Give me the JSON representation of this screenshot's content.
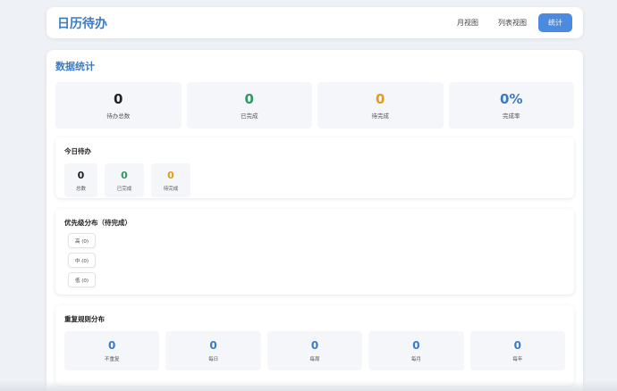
{
  "header": {
    "title": "日历待办",
    "nav": [
      {
        "label": "月视图"
      },
      {
        "label": "列表视图"
      },
      {
        "label": "统计"
      }
    ]
  },
  "stats": {
    "title": "数据统计",
    "summary": [
      {
        "value": "0",
        "label": "待办总数",
        "color": "#222222"
      },
      {
        "value": "0",
        "label": "已完成",
        "color": "#2e9a5f"
      },
      {
        "value": "0",
        "label": "待完成",
        "color": "#e59a1c"
      },
      {
        "value": "0%",
        "label": "完成率",
        "color": "#3a7bc8"
      }
    ]
  },
  "today": {
    "title": "今日待办",
    "items": [
      {
        "value": "0",
        "label": "总数"
      },
      {
        "value": "0",
        "label": "已完成"
      },
      {
        "value": "0",
        "label": "待完成"
      }
    ]
  },
  "priority": {
    "title": "优先级分布（待完成）",
    "items": [
      {
        "label": "高 (0)"
      },
      {
        "label": "中 (0)"
      },
      {
        "label": "低 (0)"
      }
    ]
  },
  "repeat": {
    "title": "重复规则分布",
    "items": [
      {
        "value": "0",
        "label": "不重复"
      },
      {
        "value": "0",
        "label": "每日"
      },
      {
        "value": "0",
        "label": "每周"
      },
      {
        "value": "0",
        "label": "每月"
      },
      {
        "value": "0",
        "label": "每年"
      }
    ]
  }
}
